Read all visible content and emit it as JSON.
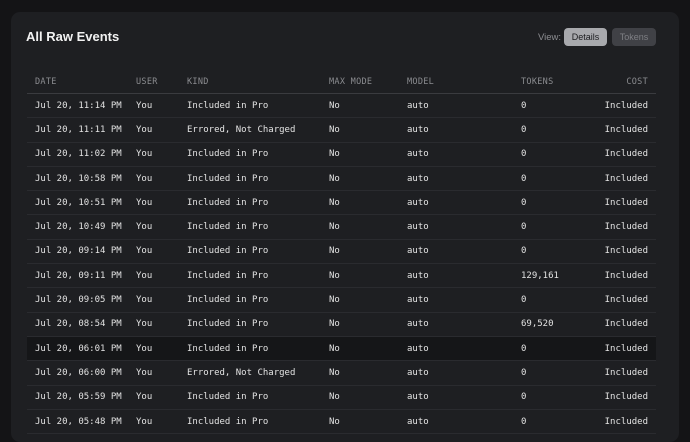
{
  "header": {
    "title": "All Raw Events",
    "view_label": "View:",
    "details_label": "Details",
    "tokens_label": "Tokens"
  },
  "table": {
    "columns": [
      "DATE",
      "USER",
      "KIND",
      "MAX MODE",
      "MODEL",
      "TOKENS",
      "COST"
    ],
    "rows": [
      [
        "Jul 20, 11:14 PM",
        "You",
        "Included in Pro",
        "No",
        "auto",
        "0",
        "Included"
      ],
      [
        "Jul 20, 11:11 PM",
        "You",
        "Errored, Not Charged",
        "No",
        "auto",
        "0",
        "Included"
      ],
      [
        "Jul 20, 11:02 PM",
        "You",
        "Included in Pro",
        "No",
        "auto",
        "0",
        "Included"
      ],
      [
        "Jul 20, 10:58 PM",
        "You",
        "Included in Pro",
        "No",
        "auto",
        "0",
        "Included"
      ],
      [
        "Jul 20, 10:51 PM",
        "You",
        "Included in Pro",
        "No",
        "auto",
        "0",
        "Included"
      ],
      [
        "Jul 20, 10:49 PM",
        "You",
        "Included in Pro",
        "No",
        "auto",
        "0",
        "Included"
      ],
      [
        "Jul 20, 09:14 PM",
        "You",
        "Included in Pro",
        "No",
        "auto",
        "0",
        "Included"
      ],
      [
        "Jul 20, 09:11 PM",
        "You",
        "Included in Pro",
        "No",
        "auto",
        "129,161",
        "Included"
      ],
      [
        "Jul 20, 09:05 PM",
        "You",
        "Included in Pro",
        "No",
        "auto",
        "0",
        "Included"
      ],
      [
        "Jul 20, 08:54 PM",
        "You",
        "Included in Pro",
        "No",
        "auto",
        "69,520",
        "Included"
      ],
      [
        "Jul 20, 06:01 PM",
        "You",
        "Included in Pro",
        "No",
        "auto",
        "0",
        "Included"
      ],
      [
        "Jul 20, 06:00 PM",
        "You",
        "Errored, Not Charged",
        "No",
        "auto",
        "0",
        "Included"
      ],
      [
        "Jul 20, 05:59 PM",
        "You",
        "Included in Pro",
        "No",
        "auto",
        "0",
        "Included"
      ],
      [
        "Jul 20, 05:48 PM",
        "You",
        "Included in Pro",
        "No",
        "auto",
        "0",
        "Included"
      ]
    ]
  }
}
